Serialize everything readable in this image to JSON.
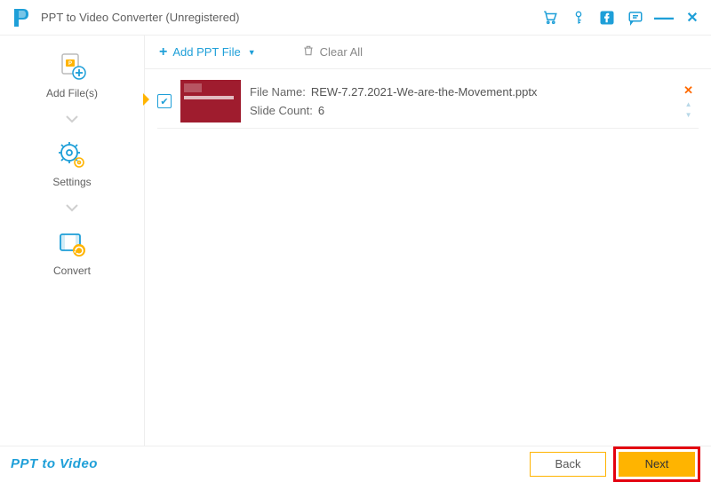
{
  "app": {
    "title": "PPT to Video Converter (Unregistered)"
  },
  "titleIcons": {
    "cart": "cart-icon",
    "key": "key-icon",
    "facebook": "facebook-icon",
    "feedback": "feedback-icon",
    "minimize": "—",
    "close": "✕"
  },
  "sidebar": {
    "addFiles": {
      "label": "Add File(s)"
    },
    "settings": {
      "label": "Settings"
    },
    "convert": {
      "label": "Convert"
    }
  },
  "toolbar": {
    "addPpt": "Add PPT File",
    "clearAll": "Clear All"
  },
  "files": [
    {
      "checked": true,
      "fileNameLabel": "File Name:",
      "fileName": "REW-7.27.2021-We-are-the-Movement.pptx",
      "slideCountLabel": "Slide Count:",
      "slideCount": "6"
    }
  ],
  "footer": {
    "brand": "PPT to Video",
    "back": "Back",
    "next": "Next"
  }
}
